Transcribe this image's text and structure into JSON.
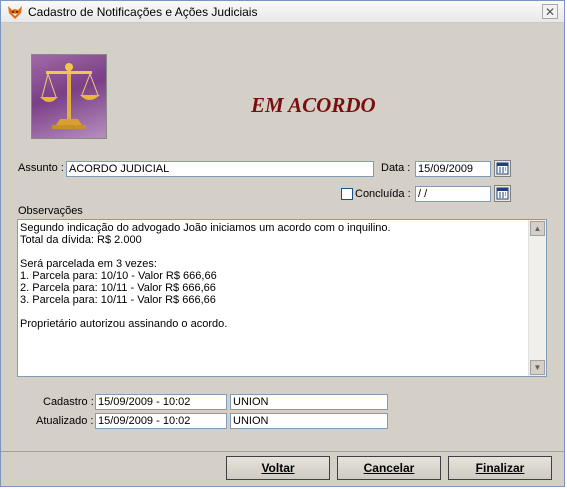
{
  "window": {
    "title": "Cadastro de Notificações e Ações Judiciais",
    "close_glyph": "✕",
    "app_icon": "fox-icon"
  },
  "header": {
    "status_text": "EM ACORDO",
    "status_color": "#7a0e0e",
    "logo_icon": "scales-of-justice-icon"
  },
  "form": {
    "assunto_label": "Assunto :",
    "assunto_value": "ACORDO JUDICIAL",
    "data_label": "Data :",
    "data_value": "15/09/2009",
    "concluida_label": "Concluída :",
    "concluida_checked": false,
    "concluida_date": " /  /",
    "observacoes_label": "Observações",
    "observacoes_lines": [
      "Segundo indicação do advogado João iniciamos um acordo com o inquilino.",
      "Total da dívida: R$ 2.000",
      "",
      "Será parcelada em 3 vezes:",
      "1. Parcela para: 10/10  - Valor R$ 666,66",
      "2. Parcela para: 10/11  - Valor R$ 666,66",
      "3. Parcela para: 10/11  - Valor R$ 666,66",
      "",
      "Proprietário autorizou assinando o acordo."
    ],
    "cadastro_label": "Cadastro :",
    "cadastro_datetime": "15/09/2009 - 10:02",
    "cadastro_user": "UNION",
    "atualizado_label": "Atualizado :",
    "atualizado_datetime": "15/09/2009 - 10:02",
    "atualizado_user": "UNION"
  },
  "buttons": {
    "voltar": "Voltar",
    "cancelar": "Cancelar",
    "finalizar": "Finalizar"
  }
}
